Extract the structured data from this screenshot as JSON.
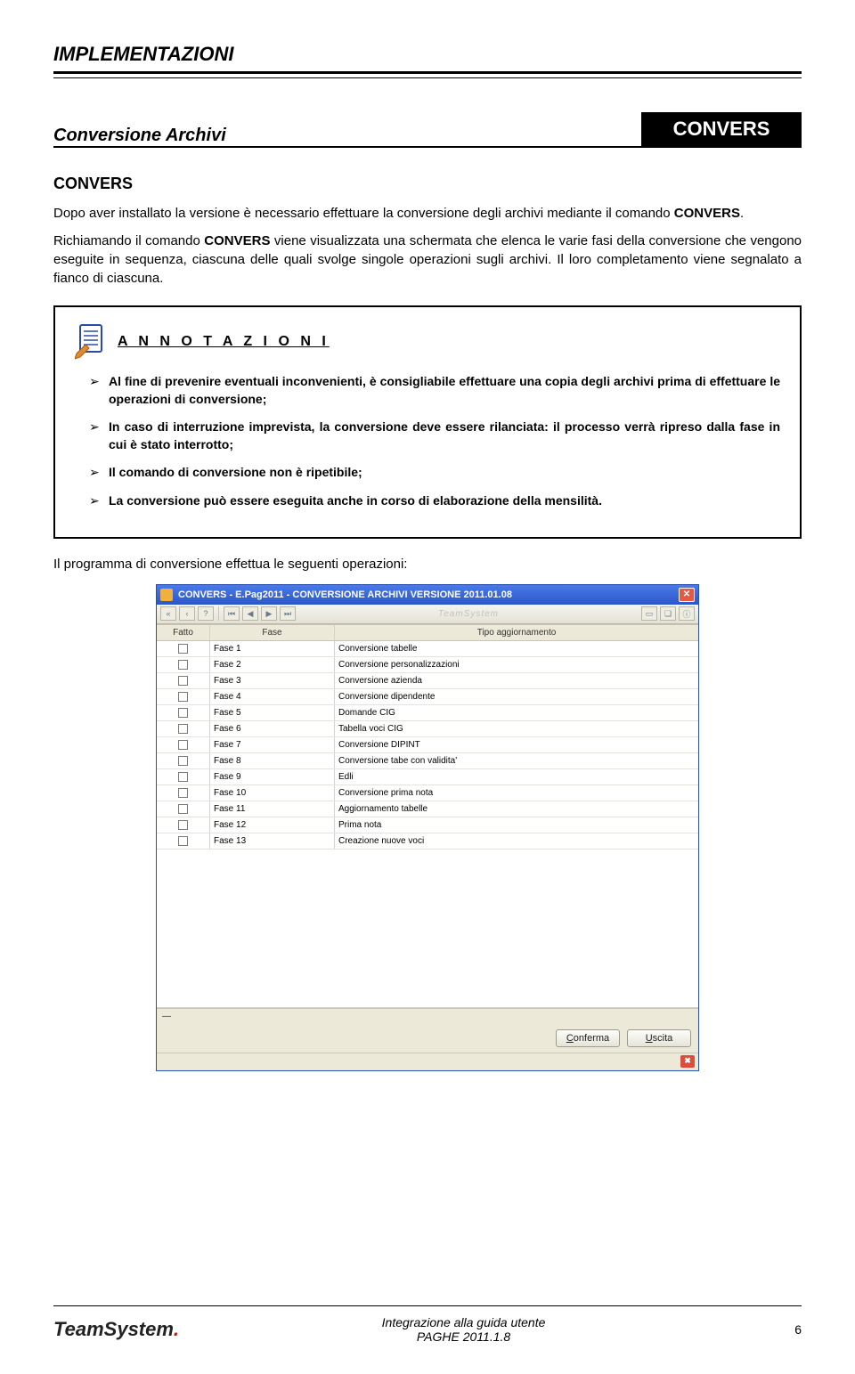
{
  "header": {
    "title": "IMPLEMENTAZIONI"
  },
  "section": {
    "left": "Conversione Archivi",
    "badge": "CONVERS"
  },
  "subhead": "CONVERS",
  "p1": "Dopo aver installato la versione è necessario effettuare la conversione degli archivi mediante il comando CONVERS.",
  "p1_bold": "CONVERS",
  "p2a": "Richiamando il comando ",
  "p2b": "CONVERS",
  "p2c": " viene visualizzata una schermata che elenca le varie fasi della conversione che vengono eseguite in sequenza, ciascuna delle quali svolge singole operazioni sugli archivi. Il loro completamento viene segnalato a fianco di ciascuna.",
  "annot": {
    "title": "A N N O T A Z I O N I",
    "items": [
      "Al fine di prevenire eventuali inconvenienti, è consigliabile effettuare una copia degli archivi prima di effettuare le operazioni di conversione;",
      "In caso di interruzione imprevista, la conversione deve essere rilanciata: il processo verrà ripreso dalla fase in cui è stato interrotto;",
      "Il comando di conversione non è ripetibile;",
      "La conversione può essere eseguita anche in corso di elaborazione della mensilità."
    ]
  },
  "intro2": "Il programma di conversione effettua le seguenti operazioni:",
  "app": {
    "title": "CONVERS - E.Pag2011 - CONVERSIONE ARCHIVI VERSIONE 2011.01.08",
    "brand": "TeamSystem",
    "columns": {
      "fatto": "Fatto",
      "fase": "Fase",
      "tipo": "Tipo aggiornamento"
    },
    "rows": [
      {
        "fase": "Fase 1",
        "tipo": "Conversione tabelle"
      },
      {
        "fase": "Fase 2",
        "tipo": "Conversione personalizzazioni"
      },
      {
        "fase": "Fase 3",
        "tipo": "Conversione azienda"
      },
      {
        "fase": "Fase 4",
        "tipo": "Conversione dipendente"
      },
      {
        "fase": "Fase 5",
        "tipo": "Domande CIG"
      },
      {
        "fase": "Fase 6",
        "tipo": "Tabella voci CIG"
      },
      {
        "fase": "Fase 7",
        "tipo": "Conversione DIPINT"
      },
      {
        "fase": "Fase 8",
        "tipo": "Conversione tabe con validita'"
      },
      {
        "fase": "Fase 9",
        "tipo": "Edli"
      },
      {
        "fase": "Fase 10",
        "tipo": "Conversione prima nota"
      },
      {
        "fase": "Fase 11",
        "tipo": "Aggiornamento tabelle"
      },
      {
        "fase": "Fase 12",
        "tipo": "Prima nota"
      },
      {
        "fase": "Fase 13",
        "tipo": "Creazione nuove voci"
      }
    ],
    "status": "—",
    "btn_confirm": "Conferma",
    "btn_exit": "Uscita"
  },
  "footer": {
    "logo": "TeamSystem",
    "line1": "Integrazione alla guida utente",
    "line2": "PAGHE 2011.1.8",
    "pagenum": "6"
  }
}
